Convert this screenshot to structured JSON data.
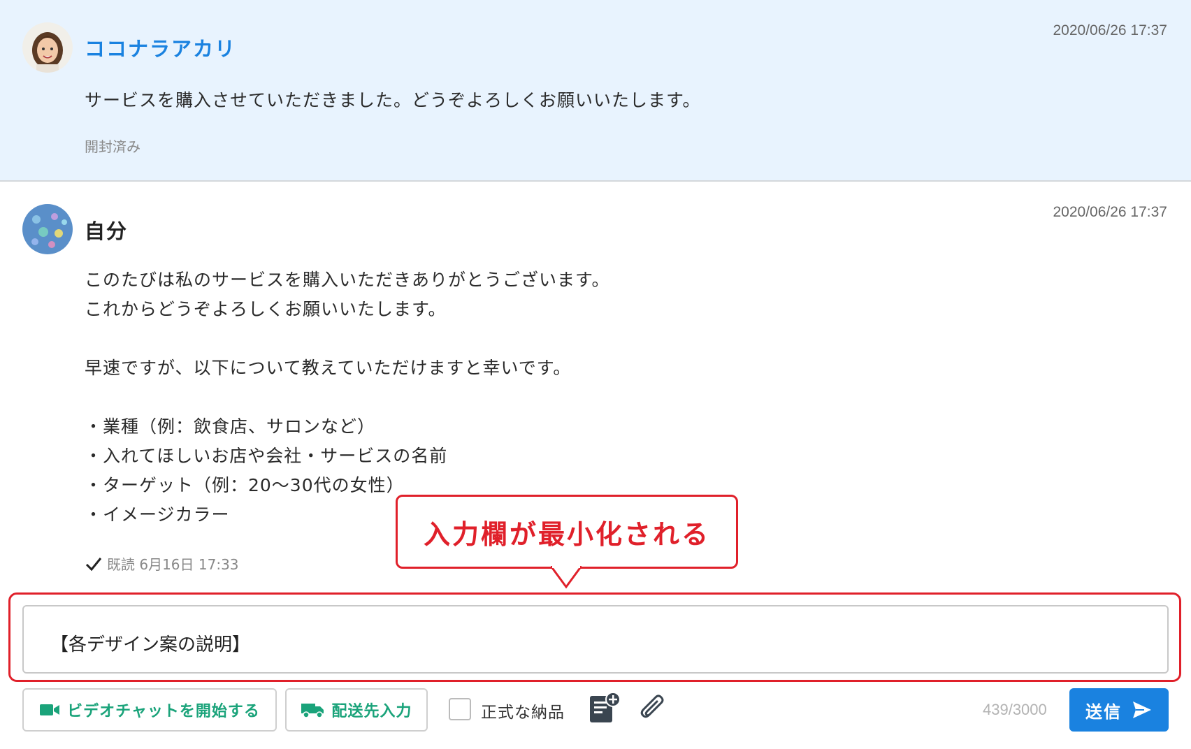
{
  "messages": [
    {
      "sender": "ココナラアカリ",
      "timestamp": "2020/06/26 17:37",
      "lines": [
        "サービスを購入させていただきました。どうぞよろしくお願いいたします。"
      ],
      "status": "開封済み"
    },
    {
      "sender": "自分",
      "timestamp": "2020/06/26 17:37",
      "lines": [
        "このたびは私のサービスを購入いただきありがとうございます。",
        "これからどうぞよろしくお願いいたします。",
        "",
        "早速ですが、以下について教えていただけますと幸いです。",
        "",
        "・業種（例：飲食店、サロンなど）",
        "・入れてほしいお店や会社・サービスの名前",
        "・ターゲット（例：20〜30代の女性）",
        "・イメージカラー"
      ],
      "status": "既読 6月16日 17:33"
    }
  ],
  "composer": {
    "text": "【各デザイン案の説明】",
    "video_chat_label": "ビデオチャットを開始する",
    "shipping_label": "配送先入力",
    "official_delivery_label": "正式な納品",
    "char_count": "439/3000",
    "send_label": "送信"
  },
  "annotation": {
    "callout_text": "入力欄が最小化される"
  },
  "colors": {
    "accent_blue": "#1a82e0",
    "accent_green": "#1aa37a",
    "annotation_red": "#e0202a",
    "message_highlight_bg": "#e8f3fe"
  },
  "icons": [
    "video-camera-icon",
    "truck-icon",
    "document-add-icon",
    "paperclip-icon",
    "send-arrow-icon",
    "check-icon"
  ]
}
